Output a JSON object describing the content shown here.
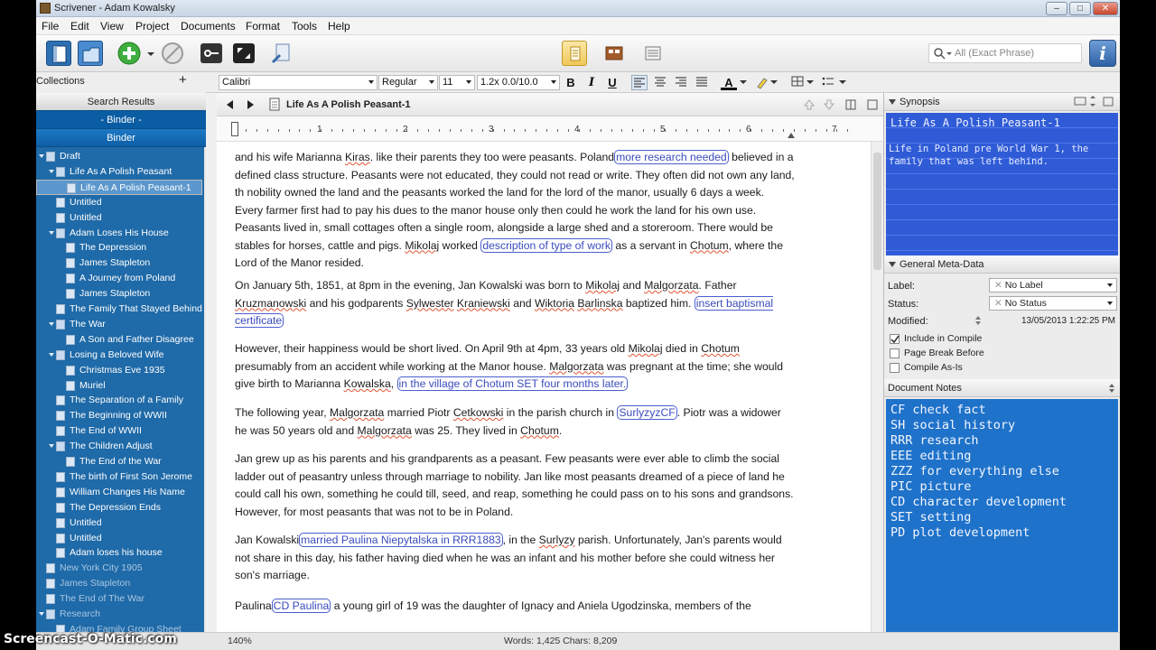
{
  "window": {
    "title": "Scrivener - Adam Kowalsky"
  },
  "menu": [
    "File",
    "Edit",
    "View",
    "Project",
    "Documents",
    "Format",
    "Tools",
    "Help"
  ],
  "toolbar": {
    "search_placeholder": "All (Exact Phrase)",
    "info_label": "i"
  },
  "format": {
    "style": "",
    "font": "Calibri",
    "weight": "Regular",
    "size": "11",
    "spacing": "1.2x 0.0/10.0",
    "bold": "B",
    "italic": "I",
    "underline": "U"
  },
  "binder": {
    "collections_label": "Collections",
    "search_results": "Search Results",
    "binder_tab_1": "- Binder -",
    "binder_tab_2": "Binder",
    "items": [
      {
        "label": "Draft",
        "level": 0,
        "type": "folder"
      },
      {
        "label": "Life As A Polish Peasant",
        "level": 1,
        "type": "stack"
      },
      {
        "label": "Life As A Polish Peasant-1",
        "level": 2,
        "type": "doc",
        "selected": true
      },
      {
        "label": "Untitled",
        "level": 1,
        "type": "doc"
      },
      {
        "label": "Untitled",
        "level": 1,
        "type": "doc"
      },
      {
        "label": "Adam Loses His House",
        "level": 1,
        "type": "stack"
      },
      {
        "label": "The Depression",
        "level": 2,
        "type": "doc"
      },
      {
        "label": "James Stapleton",
        "level": 2,
        "type": "doc"
      },
      {
        "label": "A Journey from Poland",
        "level": 2,
        "type": "doc"
      },
      {
        "label": "James Stapleton",
        "level": 2,
        "type": "doc"
      },
      {
        "label": "The Family That Stayed Behind",
        "level": 1,
        "type": "doc"
      },
      {
        "label": "The War",
        "level": 1,
        "type": "stack"
      },
      {
        "label": "A Son and Father Disagree",
        "level": 2,
        "type": "doc"
      },
      {
        "label": "Losing a Beloved Wife",
        "level": 1,
        "type": "stack"
      },
      {
        "label": "Christmas Eve 1935",
        "level": 2,
        "type": "doc"
      },
      {
        "label": "Muriel",
        "level": 2,
        "type": "doc"
      },
      {
        "label": "The Separation of a Family",
        "level": 1,
        "type": "doc"
      },
      {
        "label": "The Beginning of WWII",
        "level": 1,
        "type": "doc"
      },
      {
        "label": "The End of WWII",
        "level": 1,
        "type": "doc"
      },
      {
        "label": "The Children Adjust",
        "level": 1,
        "type": "stack"
      },
      {
        "label": "The End of the War",
        "level": 2,
        "type": "doc"
      },
      {
        "label": "The birth of First Son Jerome",
        "level": 1,
        "type": "doc"
      },
      {
        "label": "William Changes His Name",
        "level": 1,
        "type": "doc"
      },
      {
        "label": "The Depression Ends",
        "level": 1,
        "type": "doc"
      },
      {
        "label": "Untitled",
        "level": 1,
        "type": "doc"
      },
      {
        "label": "Untitled",
        "level": 1,
        "type": "doc"
      },
      {
        "label": "Adam loses his house",
        "level": 1,
        "type": "doc"
      },
      {
        "label": "New York City 1905",
        "level": 0,
        "type": "doc",
        "dim": true
      },
      {
        "label": "James Stapleton",
        "level": 0,
        "type": "doc",
        "dim": true
      },
      {
        "label": "The End of The War",
        "level": 0,
        "type": "doc",
        "dim": true
      },
      {
        "label": "Research",
        "level": 0,
        "type": "folder",
        "dim": true
      },
      {
        "label": "Adam Family Group Sheet",
        "level": 1,
        "type": "doc",
        "dim": true
      }
    ]
  },
  "editor": {
    "doc_title": "Life As A Polish Peasant-1",
    "ruler_numbers": [
      "1",
      "2",
      "3",
      "4",
      "5",
      "6",
      "7"
    ],
    "paragraphs": [
      [
        {
          "t": "and his wife Marianna "
        },
        {
          "t": "Kiras",
          "sq": true
        },
        {
          "t": ". like their parents they too were peasants. Poland"
        },
        {
          "t": "more research needed",
          "cm": true
        },
        {
          "t": " believed in a defined class structure. Peasants were not educated, they could not read or write. They often did not own any land, th nobility owned the land and the peasants worked the land for the lord of the manor, usually 6 days a week. Every farmer first had to pay his dues to the manor house only then could he work the land for his own use. Peasants lived in, small cottages  often a single room, alongside a large shed and a storeroom. There would be stables for horses, cattle and pigs. "
        },
        {
          "t": "Mikolaj",
          "sq": true
        },
        {
          "t": " worked "
        },
        {
          "t": "description of type of work",
          "cm": true
        },
        {
          "t": " as a servant in "
        },
        {
          "t": "Chotum",
          "sq": true
        },
        {
          "t": ", where the Lord of the Manor resided."
        }
      ],
      [
        {
          "t": "On January 5th, 1851, at 8pm in the evening, Jan Kowalski was born to "
        },
        {
          "t": "Mikolaj",
          "sq": true
        },
        {
          "t": " and "
        },
        {
          "t": "Malgorzata",
          "sq": true
        },
        {
          "t": ". Father "
        },
        {
          "t": "Kruzmanowski",
          "sq": true
        },
        {
          "t": " and his godparents "
        },
        {
          "t": "Sylwester",
          "sq": true
        },
        {
          "t": " "
        },
        {
          "t": "Kraniewski",
          "sq": true
        },
        {
          "t": " and "
        },
        {
          "t": "Wiktoria",
          "sq": true
        },
        {
          "t": " "
        },
        {
          "t": "Barlinska",
          "sq": true
        },
        {
          "t": " baptized him. "
        },
        {
          "t": "insert baptismal certificate",
          "cm": true
        }
      ],
      [
        {
          "t": "However, their happiness would be short lived. On April 9th at 4pm, 33 years old "
        },
        {
          "t": "Mikolaj",
          "sq": true
        },
        {
          "t": " died in "
        },
        {
          "t": "Chotum",
          "sq": true
        },
        {
          "t": " presumably from an accident while working at the Manor house.  "
        },
        {
          "t": "Malgorzata",
          "sq": true
        },
        {
          "t": " was pregnant at the time; she would give birth to Marianna "
        },
        {
          "t": "Kowalska",
          "sq": true
        },
        {
          "t": ", "
        },
        {
          "t": "in the village of Chotum SET four months later.",
          "cm": true
        }
      ],
      [
        {
          "t": " The following year, "
        },
        {
          "t": "Malgorzata",
          "sq": true
        },
        {
          "t": " married Piotr "
        },
        {
          "t": "Cetkowski",
          "sq": true
        },
        {
          "t": " in the parish church in "
        },
        {
          "t": "SurlyzyzCF",
          "cm": true
        },
        {
          "t": ". Piotr was a widower he was 50 years old and "
        },
        {
          "t": "Malgorzata",
          "sq": true
        },
        {
          "t": " was 25. They lived in "
        },
        {
          "t": "Chotum",
          "sq": true
        },
        {
          "t": "."
        }
      ],
      [
        {
          "t": "Jan grew up as his parents and his grandparents as a peasant. Few peasants were ever able to climb the social ladder out of peasantry unless through marriage to nobility. Jan like most peasants dreamed of a piece of land he could call his own, something he could till, seed, and reap, something he could pass on to his sons and grandsons.  However, for most peasants that was not to be in Poland."
        }
      ],
      [
        {
          "t": "Jan Kowalski"
        },
        {
          "t": "married Paulina Niepytalska in RRR1883",
          "cm": true
        },
        {
          "t": ", in the "
        },
        {
          "t": "Surlyzy",
          "sq": true
        },
        {
          "t": " parish. Unfortunately, Jan's parents would not share in this day, his father having died when he was an infant and his mother before she could witness her son's marriage."
        }
      ],
      [
        {
          "t": "Paulina"
        },
        {
          "t": "CD Paulina",
          "cm": true
        },
        {
          "t": " a young girl of 19 was the daughter of Ignacy and Aniela Ugodzinska, members of the"
        }
      ]
    ]
  },
  "inspector": {
    "synopsis_header": "Synopsis",
    "synopsis_title": "Life As A Polish Peasant-1",
    "synopsis_text": "Life in Poland pre World War 1, the family that was left behind.",
    "meta_header": "General Meta-Data",
    "label_caption": "Label:",
    "label_value": "No Label",
    "status_caption": "Status:",
    "status_value": "No Status",
    "modified_caption": "Modified:",
    "modified_value": "13/05/2013 1:22:25 PM",
    "include_compile": "Include in Compile",
    "page_break": "Page Break Before",
    "compile_as_is": "Compile As-Is",
    "notes_header": "Document Notes",
    "notes": [
      "CF check fact",
      "SH social history",
      "RRR research",
      "EEE editing",
      "ZZZ for everything else",
      "PIC picture",
      "CD character development",
      "SET setting",
      "PD plot development"
    ]
  },
  "footer": {
    "word_count": "Words: 1,425    Chars: 8,209",
    "zoom": "140%"
  },
  "watermark": "Screencast-O-Matic.com",
  "colors": {
    "binder_bg": "#1f6aa8",
    "synopsis_bg": "#2f5bd6",
    "notes_bg": "#1f72c9",
    "comment_border": "#4b5fcf"
  }
}
